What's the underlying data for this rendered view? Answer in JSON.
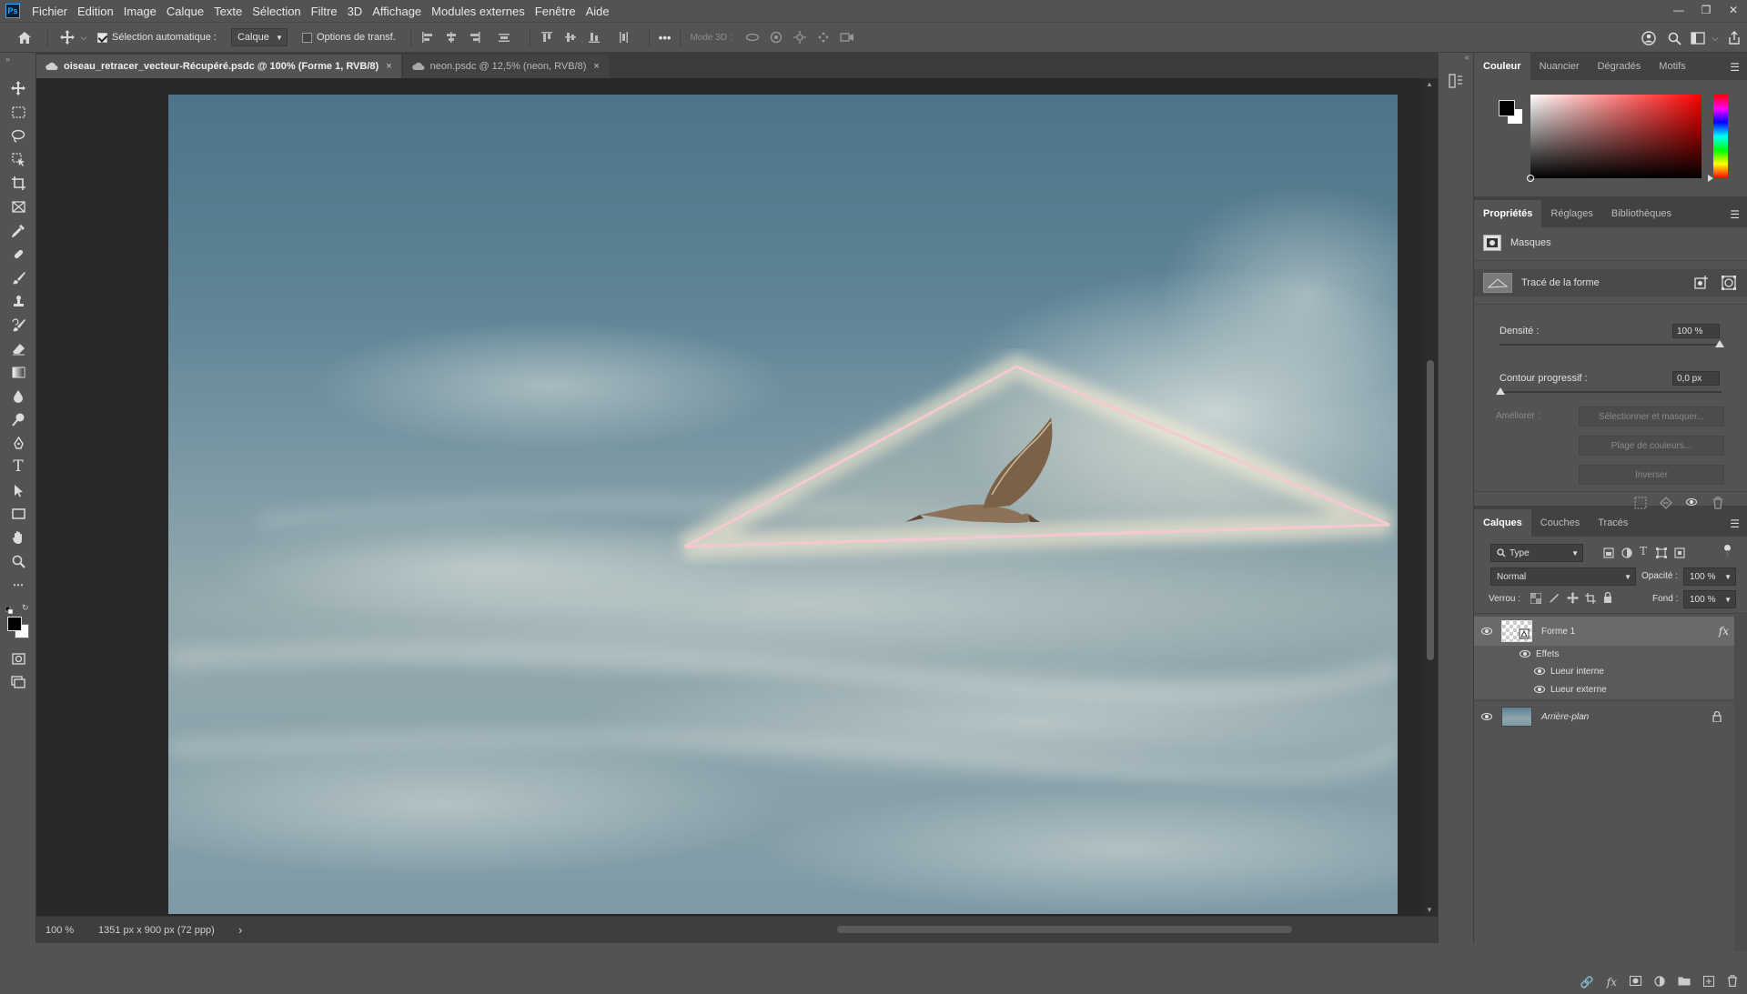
{
  "app": {
    "logo": "Ps"
  },
  "menu": [
    "Fichier",
    "Edition",
    "Image",
    "Calque",
    "Texte",
    "Sélection",
    "Filtre",
    "3D",
    "Affichage",
    "Modules externes",
    "Fenêtre",
    "Aide"
  ],
  "options": {
    "auto_select_label": "Sélection automatique :",
    "auto_select_value": "Calque",
    "transform_label": "Options de transf.",
    "more": "•••",
    "mode3d_label": "Mode 3D :"
  },
  "tabs": [
    {
      "label": "oiseau_retracer_vecteur-Récupéré.psdc @ 100% (Forme 1, RVB/8)",
      "close": "×"
    },
    {
      "label": "neon.psdc @ 12,5% (neon, RVB/8)",
      "close": "×"
    }
  ],
  "status": {
    "zoom": "100 %",
    "doc_info": "1351 px x 900 px (72 ppp)",
    "arrow": "›"
  },
  "color_panel": {
    "tabs": [
      "Couleur",
      "Nuancier",
      "Dégradés",
      "Motifs"
    ],
    "fg_color": "#000000",
    "bg_color": "#ffffff"
  },
  "properties": {
    "tabs": [
      "Propriétés",
      "Réglages",
      "Bibliothèques"
    ],
    "masks_label": "Masques",
    "shape_path_label": "Tracé de la forme",
    "density_label": "Densité :",
    "density_value": "100 %",
    "feather_label": "Contour progressif :",
    "feather_value": "0,0 px",
    "refine_label": "Améliorer :",
    "select_mask_btn": "Sélectionner et masquer...",
    "color_range_btn": "Plage de couleurs...",
    "invert_btn": "Inverser"
  },
  "layers": {
    "tabs": [
      "Calques",
      "Couches",
      "Tracés"
    ],
    "filter_type": "Type",
    "blend_mode": "Normal",
    "opacity_label": "Opacité :",
    "opacity_value": "100 %",
    "lock_label": "Verrou :",
    "fill_label": "Fond :",
    "fill_value": "100 %",
    "items": [
      {
        "name": "Forme 1",
        "fx": "fx"
      },
      {
        "name": "Effets"
      },
      {
        "name": "Lueur interne"
      },
      {
        "name": "Lueur externe"
      },
      {
        "name": "Arrière-plan"
      }
    ]
  },
  "accent": {
    "neon_stroke": "#f4c9cf",
    "glow": "#fff3d6"
  }
}
